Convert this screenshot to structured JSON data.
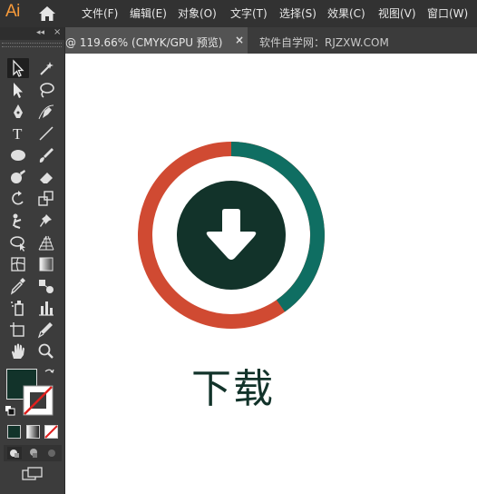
{
  "app": {
    "logo": "Ai"
  },
  "menu": [
    "文件(F)",
    "编辑(E)",
    "对象(O)",
    "文字(T)",
    "选择(S)",
    "效果(C)",
    "视图(V)",
    "窗口(W)"
  ],
  "tabs": {
    "active": "@ 119.66% (CMYK/GPU 预览)",
    "close": "×",
    "inactive": "软件自学网：RJZXW.COM"
  },
  "artwork": {
    "caption": "下载",
    "colors": {
      "ring_red": "#d04a32",
      "ring_teal": "#0f6e62",
      "circle": "#12332a",
      "text": "#12332a"
    }
  },
  "toolbox": {
    "fill_color": "#12332a",
    "tools": [
      "selection-tool",
      "magic-wand-tool",
      "direct-selection-tool",
      "lasso-tool",
      "pen-tool",
      "curvature-tool",
      "type-tool",
      "line-tool",
      "ellipse-tool",
      "paintbrush-tool",
      "shaper-tool",
      "eraser-tool",
      "rotate-tool",
      "scale-tool",
      "puppet-warp-tool",
      "pin-tool",
      "free-transform-tool",
      "perspective-grid-tool",
      "mesh-tool",
      "gradient-tool",
      "eyedropper-tool",
      "blend-tool",
      "symbol-sprayer-tool",
      "column-graph-tool",
      "artboard-tool",
      "slice-tool",
      "hand-tool",
      "zoom-tool"
    ]
  }
}
